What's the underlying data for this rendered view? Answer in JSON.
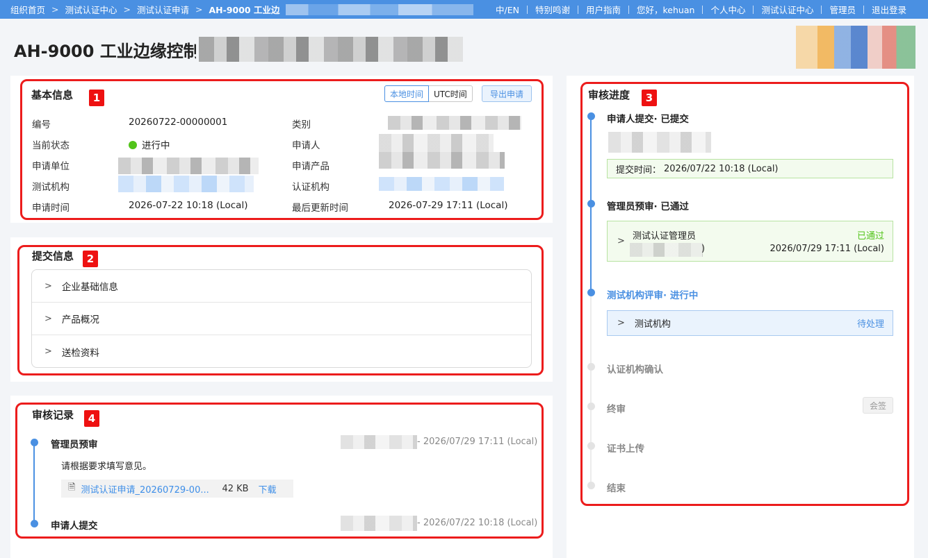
{
  "topbar": {
    "breadcrumbs": [
      "组织首页",
      "测试认证中心",
      "测试认证申请"
    ],
    "current": "AH-9000 工业边",
    "nav": [
      "中/EN",
      "特别鸣谢",
      "用户指南",
      "您好，kehuan",
      "个人中心",
      "测试认证中心",
      "管理员",
      "退出登录"
    ]
  },
  "page": {
    "title": "AH-9000 工业边缘控制器"
  },
  "basic": {
    "title": "基本信息",
    "badge": "1",
    "toggle": [
      "本地时间",
      "UTC时间"
    ],
    "export": "导出申请",
    "fields": {
      "id_label": "编号",
      "id_value": "20260722-00000001",
      "category_label": "类别",
      "status_label": "当前状态",
      "status_value": "进行中",
      "applicant_label": "申请人",
      "org_label": "申请单位",
      "product_label": "申请产品",
      "test_org_label": "测试机构",
      "cert_org_label": "认证机构",
      "time_label": "申请时间",
      "time_value": "2026-07-22 10:18 (Local)",
      "updated_label": "最后更新时间",
      "updated_value": "2026-07-29 17:11 (Local)"
    }
  },
  "submit": {
    "title": "提交信息",
    "badge": "2",
    "items": [
      "企业基础信息",
      "产品概况",
      "送检资料"
    ]
  },
  "log": {
    "title": "审核记录",
    "badge": "4",
    "entries": [
      {
        "title": "管理员预审",
        "meta": "- 2026/07/29 17:11 (Local)",
        "comment": "请根据要求填写意见。",
        "file": "测试认证申请_20260729-00...",
        "size": "42 KB",
        "download": "下载"
      },
      {
        "title": "申请人提交",
        "meta": "- 2026/07/22 10:18 (Local)"
      }
    ]
  },
  "progress": {
    "title": "审核进度",
    "badge": "3",
    "steps": [
      {
        "title": "申请人提交· 已提交",
        "time_label": "提交时间：",
        "time_value": "2026/07/22 10:18 (Local)"
      },
      {
        "title": "管理员预审· 已通过",
        "reviewer": "测试认证管理员",
        "result": "已通过",
        "suffix": ")",
        "time": "2026/07/29 17:11 (Local)"
      },
      {
        "title": "测试机构评审· 进行中",
        "reviewer": "测试机构",
        "result": "待处理"
      },
      {
        "title": "认证机构确认"
      },
      {
        "title": "终审",
        "tag": "会签"
      },
      {
        "title": "证书上传"
      },
      {
        "title": "结束"
      }
    ]
  },
  "colors": {
    "accent": "#4a90e2",
    "success": "#52c41a",
    "annotation": "#ec1c1c"
  }
}
